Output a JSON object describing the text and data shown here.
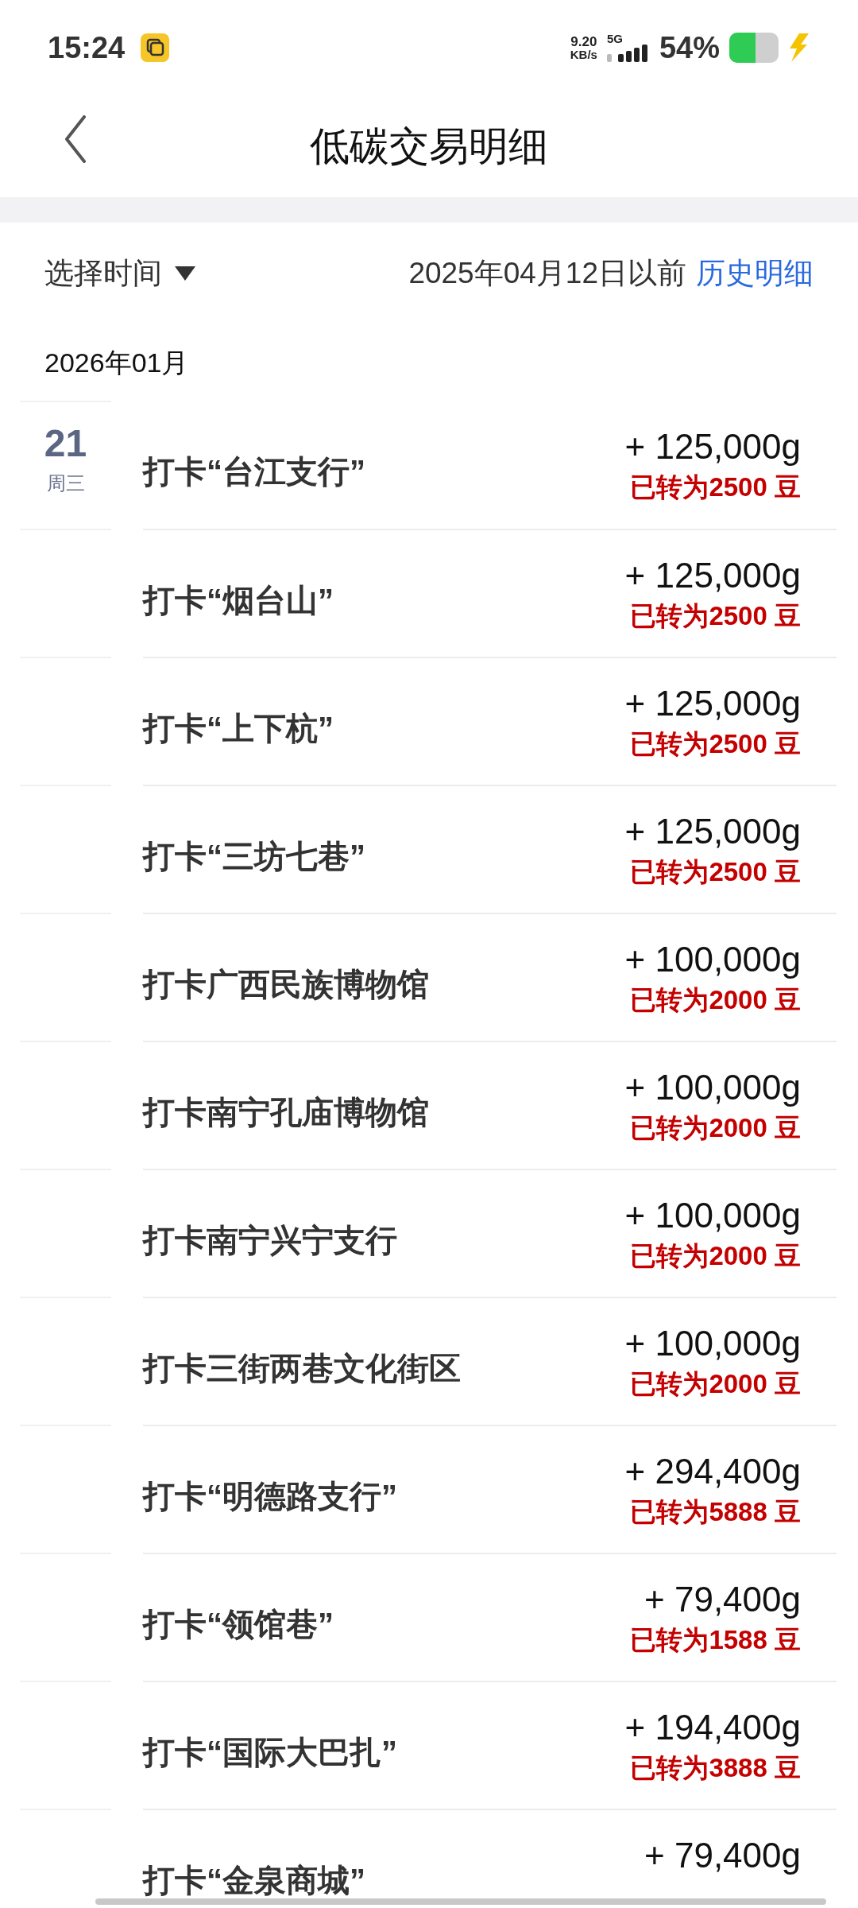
{
  "status_bar": {
    "time": "15:24",
    "net_speed": "9.20",
    "net_unit": "KB/s",
    "network": "5G",
    "battery": "54%",
    "charging": true
  },
  "header": {
    "title": "低碳交易明细"
  },
  "filter": {
    "label": "选择时间",
    "note": "2025年04月12日以前",
    "link": "历史明细"
  },
  "month": "2026年01月",
  "date": {
    "day": "21",
    "weekday": "周三"
  },
  "rows": [
    {
      "name": "打卡“台江支行”",
      "amount": "+ 125,000g",
      "converted": "已转为2500 豆"
    },
    {
      "name": "打卡“烟台山”",
      "amount": "+ 125,000g",
      "converted": "已转为2500 豆"
    },
    {
      "name": "打卡“上下杭”",
      "amount": "+ 125,000g",
      "converted": "已转为2500 豆"
    },
    {
      "name": "打卡“三坊七巷”",
      "amount": "+ 125,000g",
      "converted": "已转为2500 豆"
    },
    {
      "name": "打卡广西民族博物馆",
      "amount": "+ 100,000g",
      "converted": "已转为2000 豆"
    },
    {
      "name": "打卡南宁孔庙博物馆",
      "amount": "+ 100,000g",
      "converted": "已转为2000 豆"
    },
    {
      "name": "打卡南宁兴宁支行",
      "amount": "+ 100,000g",
      "converted": "已转为2000 豆"
    },
    {
      "name": "打卡三街两巷文化街区",
      "amount": "+ 100,000g",
      "converted": "已转为2000 豆"
    },
    {
      "name": "打卡“明德路支行”",
      "amount": "+ 294,400g",
      "converted": "已转为5888 豆"
    },
    {
      "name": "打卡“领馆巷”",
      "amount": "+ 79,400g",
      "converted": "已转为1588 豆"
    },
    {
      "name": "打卡“国际大巴扎”",
      "amount": "+ 194,400g",
      "converted": "已转为3888 豆"
    },
    {
      "name": "打卡“金泉商城”",
      "amount": "+ 79,400g"
    }
  ]
}
